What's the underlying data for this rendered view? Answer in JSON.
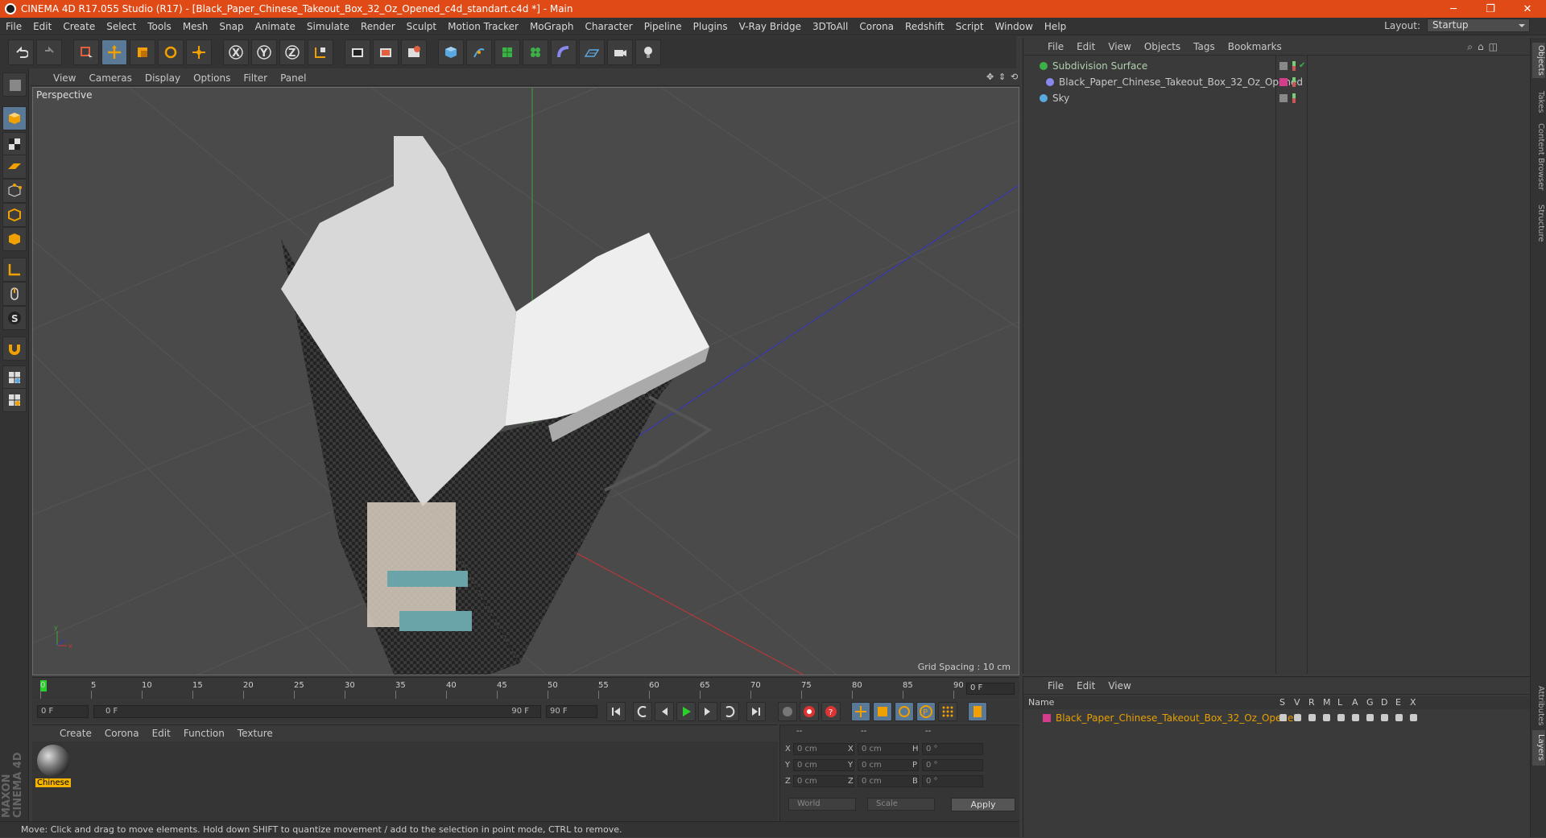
{
  "window": {
    "title": "CINEMA 4D R17.055 Studio (R17) - [Black_Paper_Chinese_Takeout_Box_32_Oz_Opened_c4d_standart.c4d *] - Main",
    "minimize": "─",
    "maximize": "❐",
    "close": "✕"
  },
  "menu": [
    "File",
    "Edit",
    "Create",
    "Select",
    "Tools",
    "Mesh",
    "Snap",
    "Animate",
    "Simulate",
    "Render",
    "Sculpt",
    "Motion Tracker",
    "MoGraph",
    "Character",
    "Pipeline",
    "Plugins",
    "V-Ray Bridge",
    "3DToAll",
    "Corona",
    "Redshift",
    "Script",
    "Window",
    "Help"
  ],
  "layout": {
    "label": "Layout:",
    "value": "Startup"
  },
  "toolbar": {
    "icons": [
      "undo-icon",
      "redo-icon",
      "live-selection-icon",
      "move-icon",
      "scale-icon",
      "rotate-icon",
      "transform-icon",
      "x-axis-icon",
      "y-axis-icon",
      "z-axis-icon",
      "coordinate-system-icon",
      "render-view-icon",
      "render-picture-viewer-icon",
      "render-settings-icon",
      "cube-icon",
      "pen-icon",
      "subdivision-icon",
      "cloner-icon",
      "deformer-icon",
      "floor-icon",
      "camera-icon",
      "light-icon"
    ],
    "axis": [
      "X",
      "Y",
      "Z"
    ]
  },
  "left_tools": [
    "make-editable-icon",
    "model-mode-icon",
    "texture-mode-icon",
    "workplane-icon",
    "points-mode-icon",
    "edges-mode-icon",
    "polygons-mode-icon",
    "axis-mode-icon",
    "tweak-icon",
    "solo-icon",
    "magnet-icon",
    "snap-grid-icon",
    "snap-settings-icon"
  ],
  "viewport": {
    "menu": [
      "View",
      "Cameras",
      "Display",
      "Options",
      "Filter",
      "Panel"
    ],
    "label": "Perspective",
    "grid_spacing": "Grid Spacing : 10 cm"
  },
  "timeline": {
    "ticks": [
      "0",
      "5",
      "10",
      "15",
      "20",
      "25",
      "30",
      "35",
      "40",
      "45",
      "50",
      "55",
      "60",
      "65",
      "70",
      "75",
      "80",
      "85",
      "90"
    ],
    "current_frame": "0 F",
    "start_field": "0 F",
    "range_start": "0 F",
    "range_end": "90 F",
    "end_field": "90 F"
  },
  "material": {
    "menu": [
      "Create",
      "Corona",
      "Edit",
      "Function",
      "Texture"
    ],
    "items": [
      {
        "name": "Chinese"
      }
    ]
  },
  "coordinates": {
    "header": [
      "--",
      "--",
      "--"
    ],
    "rows": [
      {
        "a": "X",
        "v1": "0 cm",
        "b": "X",
        "v2": "0 cm",
        "c": "H",
        "v3": "0 °"
      },
      {
        "a": "Y",
        "v1": "0 cm",
        "b": "Y",
        "v2": "0 cm",
        "c": "P",
        "v3": "0 °"
      },
      {
        "a": "Z",
        "v1": "0 cm",
        "b": "Z",
        "v2": "0 cm",
        "c": "B",
        "v3": "0 °"
      }
    ],
    "mode1": "World",
    "mode2": "Scale",
    "apply": "Apply"
  },
  "status": "Move: Click and drag to move elements. Hold down SHIFT to quantize movement / add to the selection in point mode, CTRL to remove.",
  "brand": "MAXON CINEMA 4D",
  "objects": {
    "menu": [
      "File",
      "Edit",
      "View",
      "Objects",
      "Tags",
      "Bookmarks"
    ],
    "items": [
      {
        "name": "Subdivision Surface",
        "color": "#b0d0b0"
      },
      {
        "name": "Black_Paper_Chinese_Takeout_Box_32_Oz_Opened",
        "color": "#c8c8c8"
      },
      {
        "name": "Sky",
        "color": "#c8c8c8"
      }
    ]
  },
  "layers": {
    "menu": [
      "File",
      "Edit",
      "View"
    ],
    "header_name": "Name",
    "columns": [
      "S",
      "V",
      "R",
      "M",
      "L",
      "A",
      "G",
      "D",
      "E",
      "X"
    ],
    "items": [
      {
        "name": "Black_Paper_Chinese_Takeout_Box_32_Oz_Opened",
        "color": "#e8a000",
        "swatch": "#d63c8c"
      }
    ]
  },
  "right_tabs": [
    "Objects",
    "Takes",
    "Content Browser",
    "Structure",
    "Attributes",
    "Layers"
  ],
  "colors": {
    "title_bar": "#e04a17",
    "active_tool": "#5a7996",
    "material_label": "#f2b400",
    "layer_swatch": "#d63c8c"
  }
}
